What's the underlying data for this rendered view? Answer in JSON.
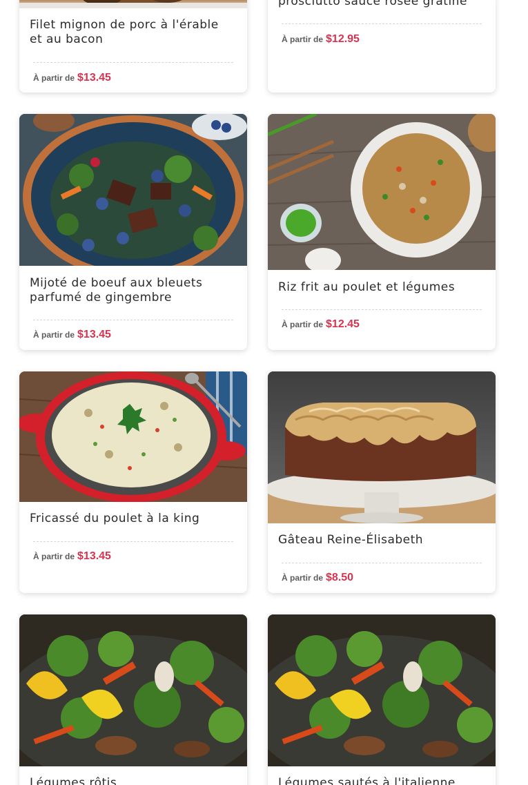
{
  "price_prefix": "À partir de",
  "colors": {
    "price": "#d6334f",
    "title": "#2b2b2b",
    "prefix": "#5c5c5c"
  },
  "items": [
    {
      "name": "Filet mignon de porc à l'érable et au bacon",
      "price": "$13.45",
      "image": "pork-tenderloin-photo"
    },
    {
      "name": "prosciutto sauce rosée gratiné",
      "price": "$12.95",
      "image": "none"
    },
    {
      "name": "Mijoté de boeuf aux bleuets parfumé de gingembre",
      "price": "$13.45",
      "image": "beef-blueberry-stew-photo"
    },
    {
      "name": "Riz frit au poulet et légumes",
      "price": "$12.45",
      "image": "chicken-fried-rice-photo"
    },
    {
      "name": "Fricassé du poulet à la king",
      "price": "$13.45",
      "image": "chicken-a-la-king-photo"
    },
    {
      "name": "Gâteau Reine-Élisabeth",
      "price": "$8.50",
      "image": "queen-elizabeth-cake-photo"
    },
    {
      "name": "Légumes rôtis",
      "price": "",
      "image": "roasted-vegetables-photo"
    },
    {
      "name": "Légumes sautés à l'italienne",
      "price": "",
      "image": "sauteed-vegetables-photo"
    }
  ]
}
